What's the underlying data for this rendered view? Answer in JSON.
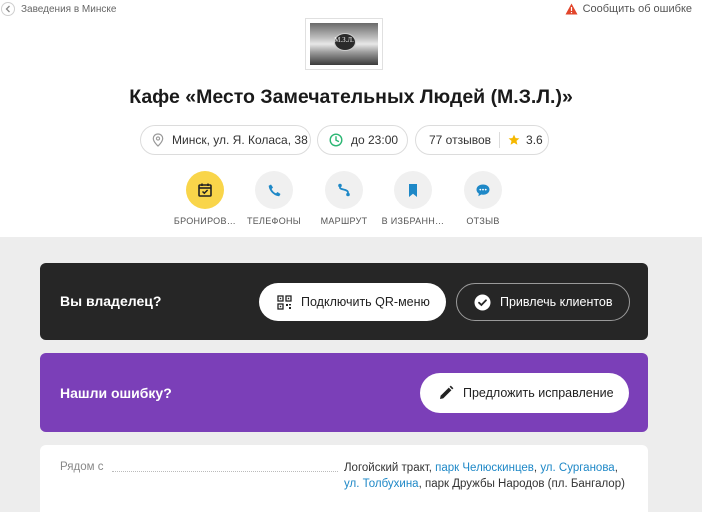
{
  "topbar": {
    "back_label": "Заведения в Минске",
    "report_label": "Сообщить об ошибке"
  },
  "logo": {
    "text": "М.З.Л."
  },
  "place": {
    "title": "Кафе «Место Замечательных Людей (М.З.Л.)»",
    "address": "Минск, ул. Я. Коласа, 38",
    "hours": "до 23:00",
    "reviews": "77 отзывов",
    "rating": "3.6"
  },
  "actions": [
    {
      "label": "БРОНИРОВ…",
      "icon": "calendar-icon"
    },
    {
      "label": "ТЕЛЕФОНЫ",
      "icon": "phone-icon"
    },
    {
      "label": "МАРШРУТ",
      "icon": "route-icon"
    },
    {
      "label": "В ИЗБРАНН…",
      "icon": "bookmark-icon"
    },
    {
      "label": "ОТЗЫВ",
      "icon": "chat-bubble-icon"
    }
  ],
  "owner_card": {
    "heading": "Вы владелец?",
    "qr_button": "Подключить QR-меню",
    "attract_button": "Привлечь клиентов"
  },
  "error_card": {
    "heading": "Нашли ошибку?",
    "suggest_button": "Предложить исправление"
  },
  "nearby": {
    "label": "Рядом с",
    "parts": [
      {
        "text": "Логойский тракт, ",
        "link": false
      },
      {
        "text": "парк Челюскинцев",
        "link": true
      },
      {
        "text": ", ",
        "link": false
      },
      {
        "text": "ул. Сурганова",
        "link": true
      },
      {
        "text": ", ",
        "link": false
      },
      {
        "text": "ул. Толбухина",
        "link": true
      },
      {
        "text": ", парк Дружбы Народов (пл. Бангалор)",
        "link": false
      }
    ]
  },
  "colors": {
    "accent_yellow": "#f9d54a",
    "link_blue": "#1e88c7",
    "dark_card": "#262626",
    "purple_card": "#7b3fb8",
    "warning_red": "#e2452b",
    "hours_green": "#2bb673",
    "star_yellow": "#f5b800"
  }
}
